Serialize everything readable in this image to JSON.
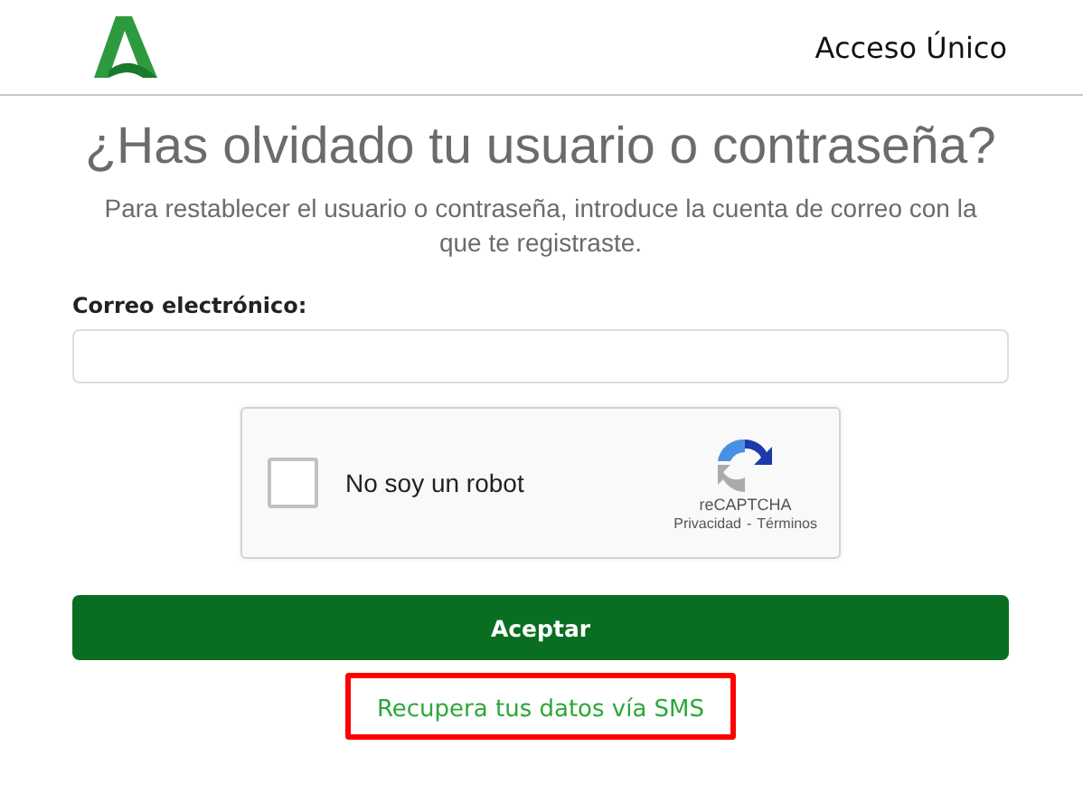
{
  "header": {
    "title": "Acceso Único"
  },
  "heading": "¿Has olvidado tu usuario o contraseña?",
  "intro": "Para restablecer el usuario o contraseña, introduce la cuenta de correo con la que te registraste.",
  "email_field": {
    "label": "Correo electrónico:"
  },
  "captcha": {
    "label": "No soy un robot",
    "checked": false,
    "brand": "reCAPTCHA",
    "links": [
      "Privacidad",
      "Términos"
    ],
    "separator": "-"
  },
  "submit_button": "Aceptar",
  "sms_link": {
    "label": "Recupera tus datos vía SMS",
    "highlighted": true
  }
}
